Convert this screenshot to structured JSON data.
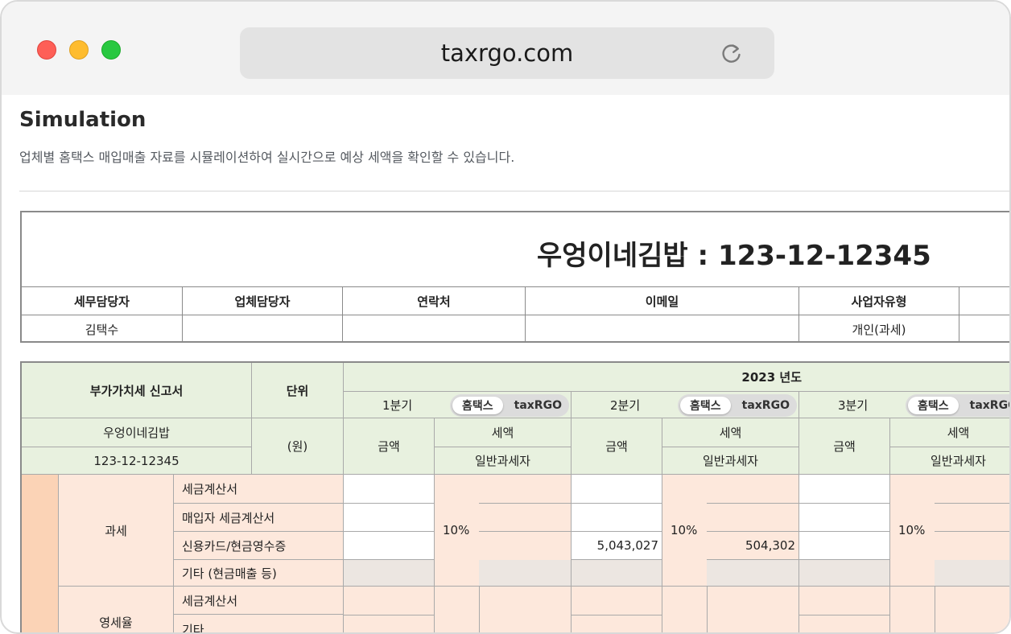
{
  "browser": {
    "url": "taxrgo.com"
  },
  "page": {
    "title": "Simulation",
    "description": "업체별 홈택스 매입매출 자료를 시뮬레이션하여 실시간으로 예상 세액을 확인할 수 있습니다."
  },
  "company_header": {
    "title": "우엉이네김밥 : 123-12-12345",
    "columns": [
      "세무담당자",
      "업체담당자",
      "연락처",
      "이메일",
      "사업자유형"
    ],
    "values": [
      "김택수",
      "",
      "",
      "",
      "개인(과세)"
    ]
  },
  "vat": {
    "report_title": "부가가치세 신고서",
    "unit_label": "단위",
    "unit_value": "(원)",
    "company_name": "우엉이네김밥",
    "biz_number": "123-12-12345",
    "year": "2023 년도",
    "quarters": [
      {
        "label": "1분기",
        "toggle_on": "홈택스",
        "toggle_off": "taxRGO"
      },
      {
        "label": "2분기",
        "toggle_on": "홈택스",
        "toggle_off": "taxRGO"
      },
      {
        "label": "3분기",
        "toggle_on": "홈택스",
        "toggle_off": "taxRGO"
      }
    ],
    "amount_label": "금액",
    "tax_label": "세액",
    "taxpayer_type": "일반과세자",
    "sections": {
      "taxable": "과세",
      "zero_rate": "영세율"
    },
    "rows": {
      "tax_invoice": "세금계산서",
      "buyer_invoice": "매입자 세금계산서",
      "card_receipt": "신용카드/현금영수증",
      "other_cash": "기타 (현금매출 등)",
      "zr_invoice": "세금계산서",
      "zr_other": "기타"
    },
    "rate": "10%",
    "q2_card_amount": "5,043,027",
    "q2_card_tax": "504,302"
  }
}
